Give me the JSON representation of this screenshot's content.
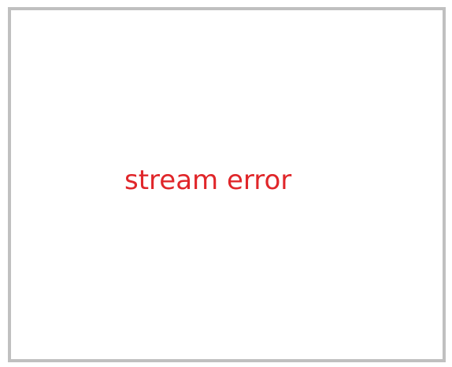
{
  "player": {
    "error_message": "stream error"
  },
  "colors": {
    "border": "#c0c0c0",
    "background": "#ffffff",
    "error_text": "#e0262a"
  }
}
